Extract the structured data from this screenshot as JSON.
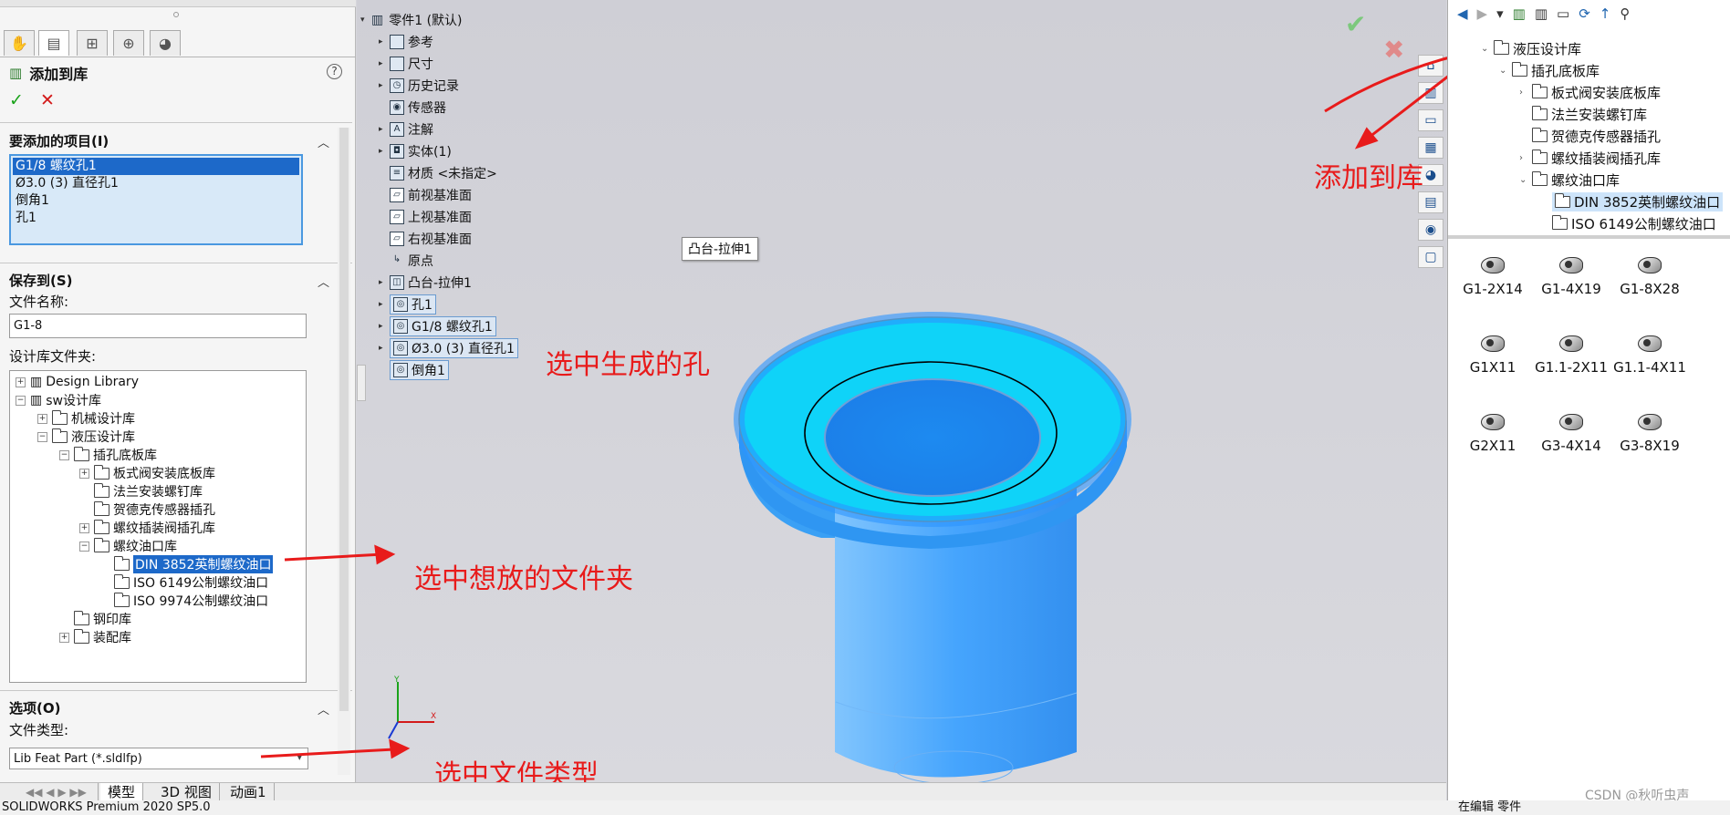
{
  "left_panel": {
    "title": "添加到库",
    "help": "?",
    "ok": "✓",
    "cancel": "✕",
    "items_section": "要添加的项目(I)",
    "items": [
      "G1/8 螺纹孔1",
      "Ø3.0 (3) 直径孔1",
      "倒角1",
      "孔1"
    ],
    "save_section": "保存到(S)",
    "filename_label": "文件名称:",
    "filename_value": "G1-8",
    "folder_label": "设计库文件夹:",
    "tree": {
      "design_library": "Design Library",
      "sw": "sw设计库",
      "mech": "机械设计库",
      "hyd": "液压设计库",
      "cartridge": "插孔底板库",
      "plate": "板式阀安装底板库",
      "flange": "法兰安装螺钉库",
      "hydac": "贺德克传感器插孔",
      "thread_cart": "螺纹插装阀插孔库",
      "thread_port": "螺纹油口库",
      "din": "DIN 3852英制螺纹油口",
      "iso6149": "ISO 6149公制螺纹油口",
      "iso9974": "ISO 9974公制螺纹油口",
      "stamp": "钢印库",
      "assembly": "装配库"
    },
    "options_section": "选项(O)",
    "filetype_label": "文件类型:",
    "filetype_value": "Lib Feat Part (*.sldlfp)"
  },
  "feature_tree": {
    "root": "零件1 (默认)",
    "items": [
      "参考",
      "尺寸",
      "历史记录",
      "传感器",
      "注解",
      "实体(1)",
      "材质 <未指定>",
      "前视基准面",
      "上视基准面",
      "右视基准面",
      "原点",
      "凸台-拉伸1",
      "孔1",
      "G1/8 螺纹孔1",
      "Ø3.0 (3) 直径孔1",
      "倒角1"
    ]
  },
  "tooltip": "凸台-拉伸1",
  "annotations": {
    "select_hole": "选中生成的孔",
    "select_folder": "选中想放的文件夹",
    "select_type": "选中文件类型",
    "add_to_lib": "添加到库"
  },
  "axis": {
    "x": "X",
    "y": "Y"
  },
  "bottom_tabs": [
    "模型",
    "3D 视图",
    "动画1"
  ],
  "status_left": "SOLIDWORKS Premium 2020 SP5.0",
  "status_right": "在编辑 零件",
  "watermark": "CSDN @秋听虫声",
  "right_panel": {
    "tree": {
      "hyd": "液压设计库",
      "cartridge": "插孔底板库",
      "plate": "板式阀安装底板库",
      "flange": "法兰安装螺钉库",
      "hydac": "贺德克传感器插孔",
      "thread_cart": "螺纹插装阀插孔库",
      "thread_port": "螺纹油口库",
      "din": "DIN 3852英制螺纹油口",
      "iso6149": "ISO 6149公制螺纹油口"
    },
    "parts": [
      "G1-2X14",
      "G1-4X19",
      "G1-8X28",
      "G1X11",
      "G1.1-2X11",
      "G1.1-4X11",
      "G2X11",
      "G3-4X14",
      "G3-8X19"
    ]
  },
  "colors": {
    "accent": "#1d69c9",
    "annotation": "#e81b1b",
    "model": "#2a9bf5"
  }
}
